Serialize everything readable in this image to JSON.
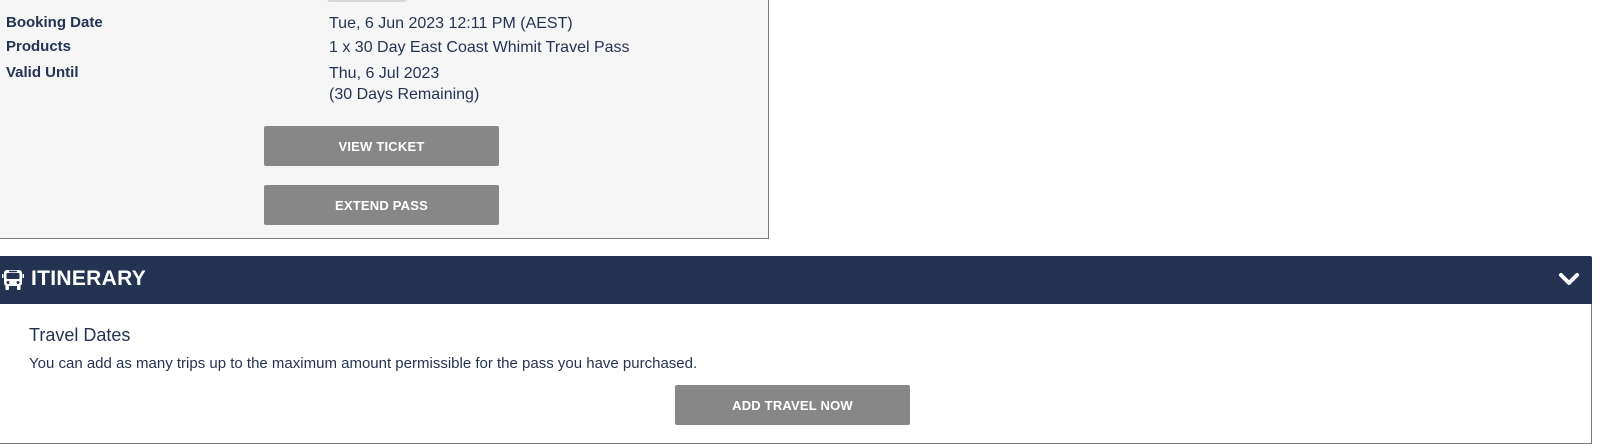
{
  "booking": {
    "rows": [
      {
        "label": "Booking Date",
        "value": "Tue, 6 Jun 2023 12:11 PM (AEST)"
      },
      {
        "label": "Products",
        "value": "1 x 30 Day East Coast Whimit Travel Pass"
      },
      {
        "label": "Valid Until",
        "value": "Thu, 6 Jul 2023",
        "value_extra": "(30 Days Remaining)"
      }
    ],
    "view_ticket_label": "VIEW TICKET",
    "extend_pass_label": "EXTEND PASS"
  },
  "itinerary": {
    "title": "ITINERARY",
    "icon": "bus-icon",
    "toggle_icon": "chevron-down-icon",
    "travel_dates_title": "Travel Dates",
    "travel_dates_desc": "You can add as many trips up to the maximum amount permissible for the pass you have purchased.",
    "add_travel_label": "ADD TRAVEL NOW"
  },
  "colors": {
    "header_bg": "#253352",
    "button_bg": "#878787",
    "panel_bg": "#f6f6f6",
    "text": "#253352"
  }
}
